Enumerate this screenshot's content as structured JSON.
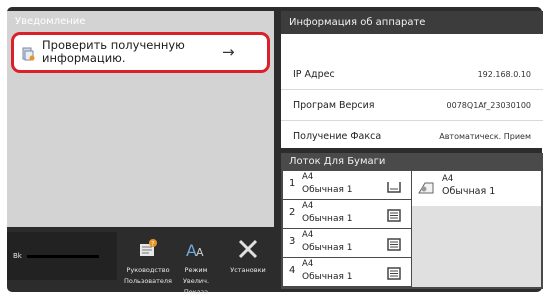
{
  "notification": {
    "title": "Уведомление",
    "item_text": "Проверить полученную информацию."
  },
  "toolbar": {
    "toner_label": "Bk",
    "tools": [
      {
        "label": "Руководство Пользователя",
        "icon": "user-guide-icon"
      },
      {
        "label": "Режим Увелич. Показа",
        "icon": "magnify-display-icon"
      },
      {
        "label": "Установки",
        "icon": "settings-tools-icon"
      }
    ]
  },
  "device_info": {
    "title": "Информация об аппарате",
    "rows": [
      {
        "label": "IP Адрес",
        "value": "192.168.0.10"
      },
      {
        "label": "Програм Версия",
        "value": "0078Q1Af_23030100"
      },
      {
        "label": "Получение Факса",
        "value": "Автоматическ. Прием"
      }
    ]
  },
  "paper_tray": {
    "title": "Лоток Для Бумаги",
    "trays": [
      {
        "num": "1",
        "size": "A4",
        "type": "Обычная 1"
      },
      {
        "num": "2",
        "size": "A4",
        "type": "Обычная 1"
      },
      {
        "num": "3",
        "size": "A4",
        "type": "Обычная 1"
      },
      {
        "num": "4",
        "size": "A4",
        "type": "Обычная 1"
      }
    ],
    "bypass": {
      "size": "A4",
      "type": "Обычная 1"
    }
  },
  "colors": {
    "alert_border": "#d9202b",
    "panel_dark": "#2c2c2c"
  }
}
